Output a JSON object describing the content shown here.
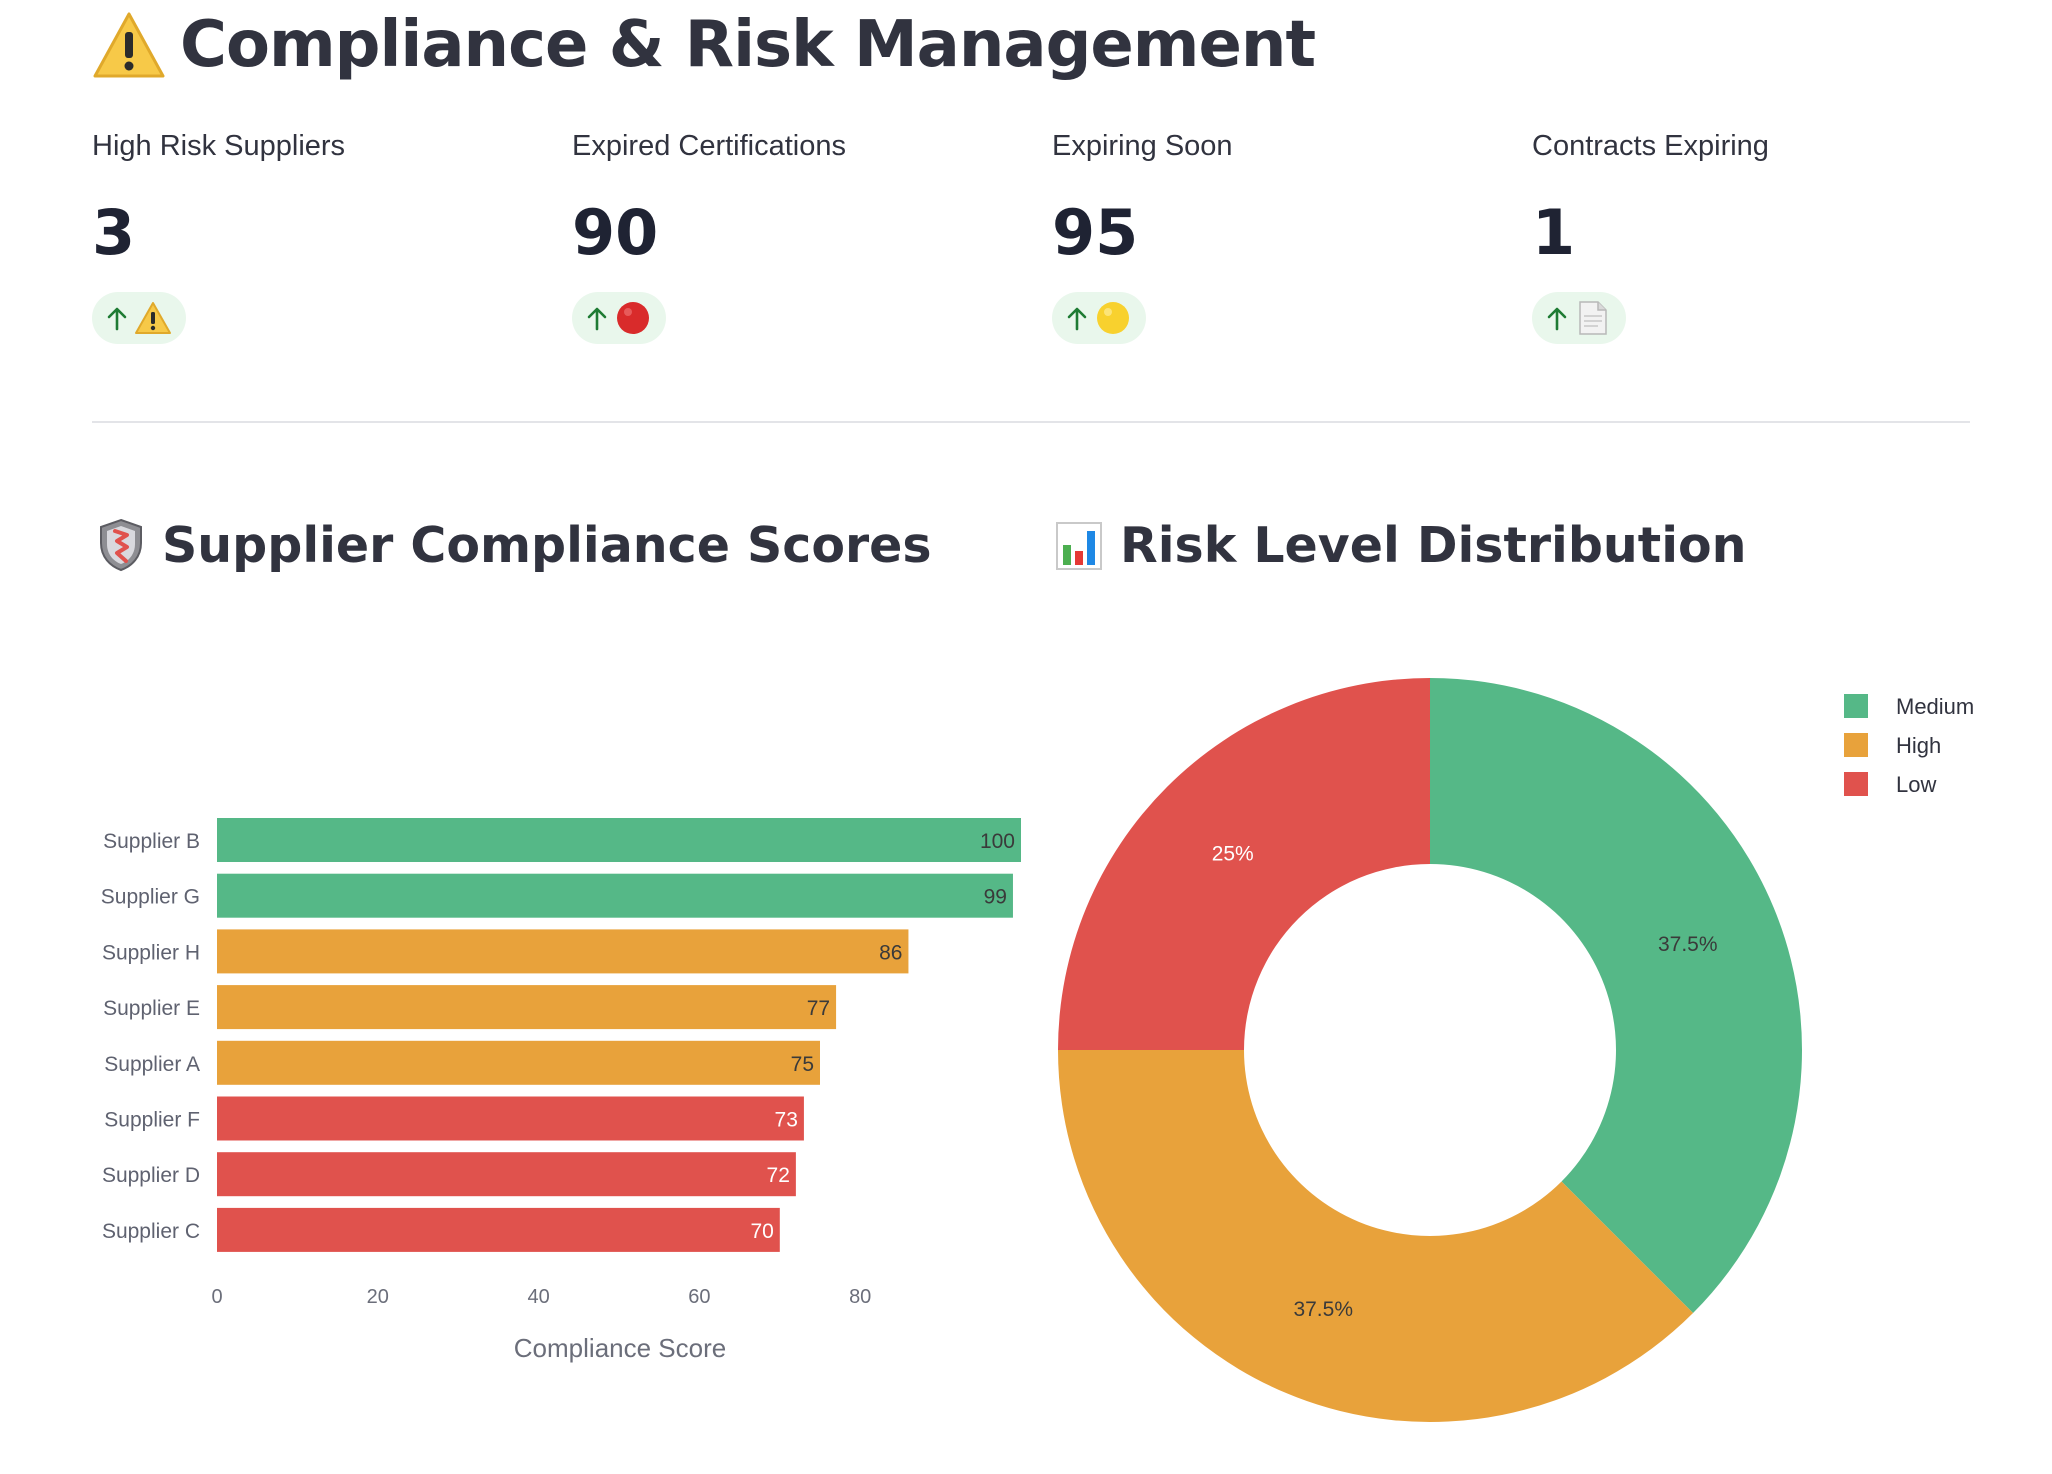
{
  "header": {
    "title": "Compliance & Risk Management",
    "icon": "warning-icon"
  },
  "metrics": [
    {
      "label": "High Risk Suppliers",
      "value": "3",
      "delta_icon": "warning-icon"
    },
    {
      "label": "Expired Certifications",
      "value": "90",
      "delta_icon": "red-circle-icon"
    },
    {
      "label": "Expiring Soon",
      "value": "95",
      "delta_icon": "yellow-circle-icon"
    },
    {
      "label": "Contracts Expiring",
      "value": "1",
      "delta_icon": "document-icon"
    }
  ],
  "sections": {
    "compliance_title": "Supplier Compliance Scores",
    "compliance_icon": "shield-icon",
    "risk_title": "Risk Level Distribution",
    "risk_icon": "bar-chart-icon"
  },
  "colors": {
    "green": "#55b887",
    "orange": "#e8a23b",
    "red": "#e0524d",
    "delta_bg": "#e9f7ec",
    "delta_arrow": "#1e7b33"
  },
  "chart_data": [
    {
      "type": "bar",
      "orientation": "horizontal",
      "categories": [
        "Supplier B",
        "Supplier G",
        "Supplier H",
        "Supplier E",
        "Supplier A",
        "Supplier F",
        "Supplier D",
        "Supplier C"
      ],
      "values": [
        100,
        99,
        86,
        77,
        75,
        73,
        72,
        70
      ],
      "bar_colors": [
        "#55b887",
        "#55b887",
        "#e8a23b",
        "#e8a23b",
        "#e8a23b",
        "#e0524d",
        "#e0524d",
        "#e0524d"
      ],
      "value_labels": [
        "100",
        "99",
        "86",
        "77",
        "75",
        "73",
        "72",
        "70"
      ],
      "xlabel": "Compliance Score",
      "xticks": [
        0,
        20,
        40,
        60,
        80
      ],
      "xlim": [
        0,
        100
      ],
      "grid": false
    },
    {
      "type": "pie",
      "hole": 0.5,
      "labels": [
        "Medium",
        "High",
        "Low"
      ],
      "values": [
        37.5,
        37.5,
        25
      ],
      "slice_labels": [
        "37.5%",
        "37.5%",
        "25%"
      ],
      "colors": [
        "#55b887",
        "#e8a23b",
        "#e0524d"
      ],
      "legend": "top-right"
    }
  ]
}
